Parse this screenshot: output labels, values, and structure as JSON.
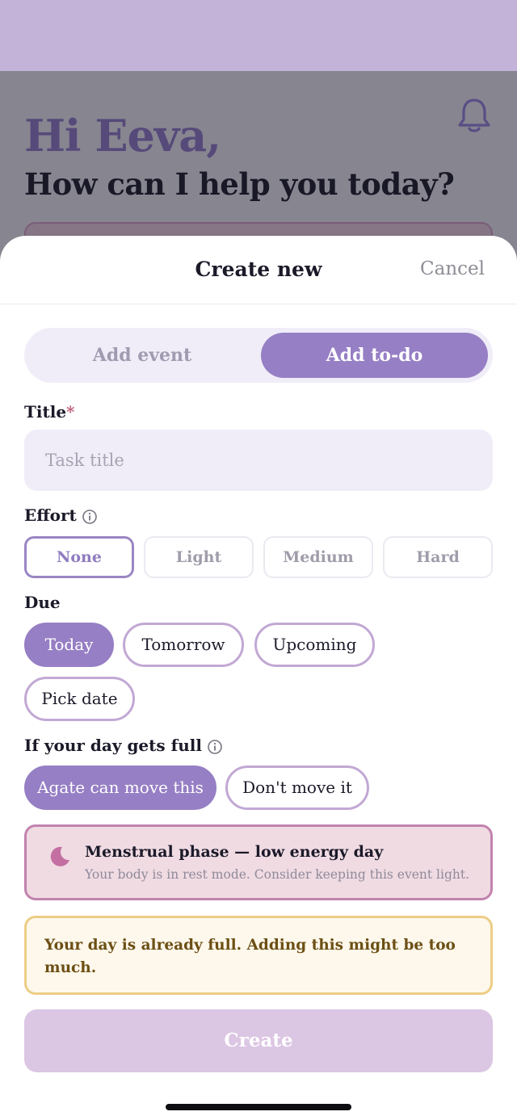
{
  "background": {
    "greeting": "Hi Eeva,",
    "subtitle": "How can I help you today?"
  },
  "sheet": {
    "title": "Create new",
    "cancel_label": "Cancel"
  },
  "segment": {
    "options": [
      "Add event",
      "Add to-do"
    ],
    "selected": "Add to-do"
  },
  "form": {
    "title_label": "Title",
    "required_mark": "*",
    "title_value": "",
    "title_placeholder": "Task title",
    "effort_label": "Effort",
    "effort_options": [
      "None",
      "Light",
      "Medium",
      "Hard"
    ],
    "effort_selected": "None",
    "due_label": "Due",
    "due_options": [
      "Today",
      "Tomorrow",
      "Upcoming",
      "Pick date"
    ],
    "due_selected": "Today",
    "full_label": "If your day gets full",
    "full_options": [
      "Agate can move this",
      "Don't move it"
    ],
    "full_selected": "Agate can move this"
  },
  "phase_notice": {
    "title": "Menstrual phase — low energy day",
    "text": "Your body is in rest mode. Consider keeping this event light.",
    "icon": "moon-icon"
  },
  "warning": {
    "text": "Your day is already full. Adding this might be too much."
  },
  "create_label": "Create",
  "colors": {
    "accent": "#967fc4",
    "header_band": "#c4b3d9",
    "phase_border": "#c283ae",
    "warning_border": "#edcd86",
    "warning_text": "#6c4f14"
  }
}
